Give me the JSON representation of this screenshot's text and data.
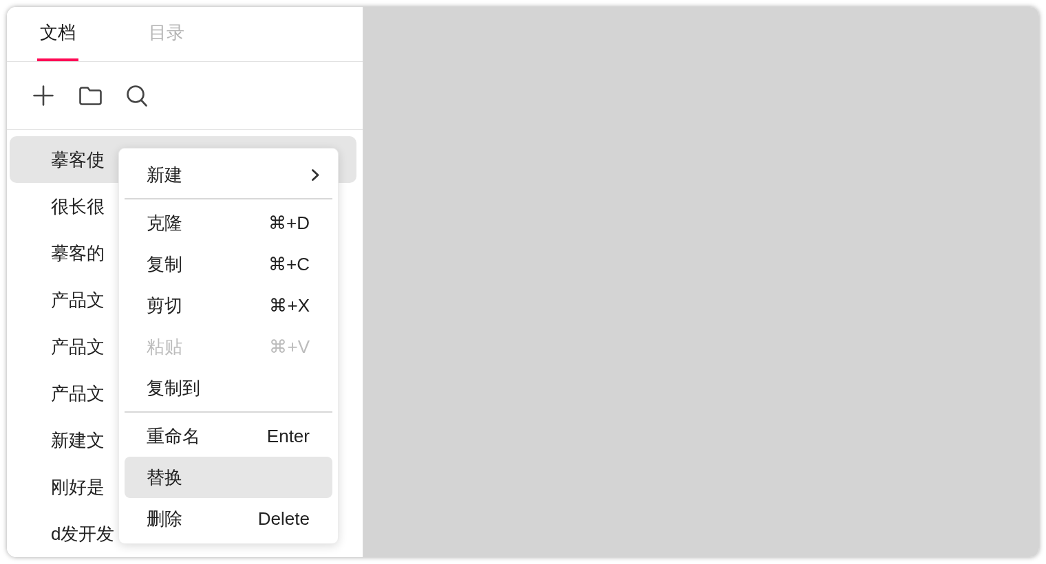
{
  "tabs": [
    {
      "label": "文档",
      "selected": true
    },
    {
      "label": "目录",
      "selected": false
    }
  ],
  "documents": [
    {
      "title": "摹客使",
      "selected": true
    },
    {
      "title": "很长很",
      "selected": false
    },
    {
      "title": "摹客的",
      "selected": false
    },
    {
      "title": "产品文",
      "selected": false
    },
    {
      "title": "产品文",
      "selected": false
    },
    {
      "title": "产品文",
      "selected": false
    },
    {
      "title": "新建文",
      "selected": false
    },
    {
      "title": "刚好是",
      "selected": false
    },
    {
      "title": "d发开发",
      "selected": false
    }
  ],
  "context_menu": {
    "groups": [
      {
        "items": [
          {
            "label": "新建",
            "submenu": true,
            "disabled": false,
            "highlighted": false
          }
        ]
      },
      {
        "items": [
          {
            "label": "克隆",
            "shortcut": "⌘+D",
            "submenu": false,
            "disabled": false,
            "highlighted": false
          },
          {
            "label": "复制",
            "shortcut": "⌘+C",
            "submenu": false,
            "disabled": false,
            "highlighted": false
          },
          {
            "label": "剪切",
            "shortcut": "⌘+X",
            "submenu": false,
            "disabled": false,
            "highlighted": false
          },
          {
            "label": "粘贴",
            "shortcut": "⌘+V",
            "submenu": false,
            "disabled": true,
            "highlighted": false
          },
          {
            "label": "复制到",
            "submenu": false,
            "disabled": false,
            "highlighted": false
          }
        ]
      },
      {
        "items": [
          {
            "label": "重命名",
            "shortcut": "Enter",
            "submenu": false,
            "disabled": false,
            "highlighted": false
          },
          {
            "label": "替换",
            "submenu": false,
            "disabled": false,
            "highlighted": true
          },
          {
            "label": "删除",
            "shortcut": "Delete",
            "submenu": false,
            "disabled": false,
            "highlighted": false
          }
        ]
      }
    ]
  }
}
